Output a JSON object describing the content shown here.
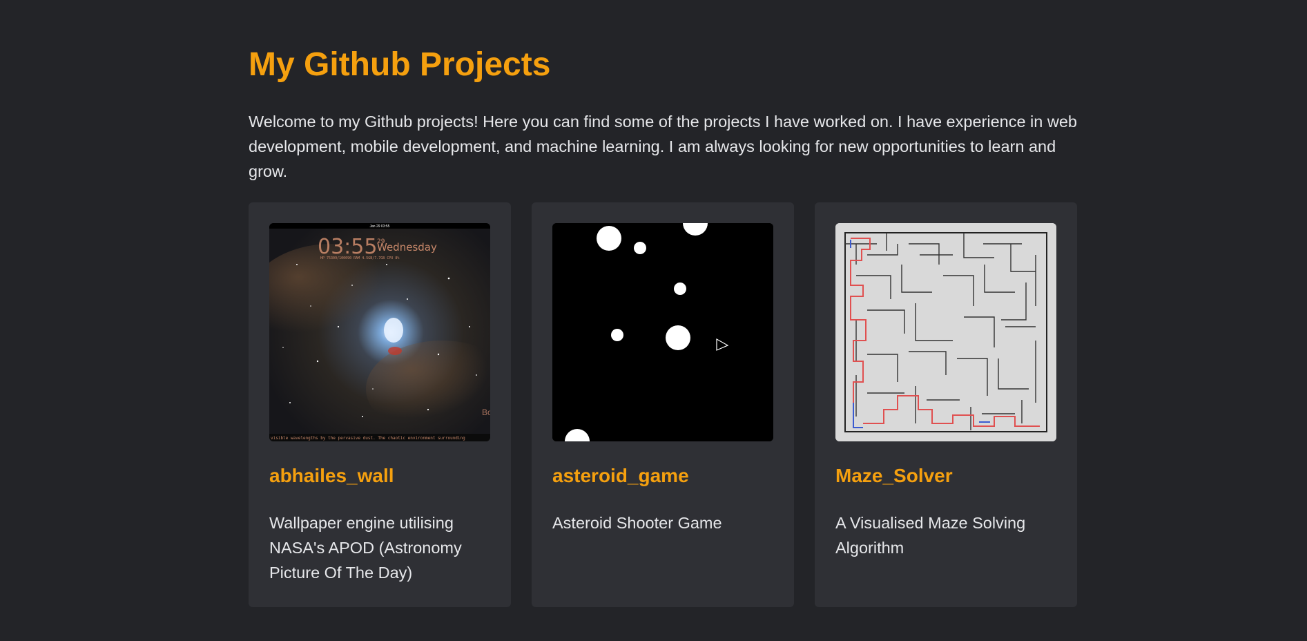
{
  "page": {
    "title": "My Github Projects",
    "intro": "Welcome to my Github projects! Here you can find some of the projects I have worked on. I have experience in web development, mobile development, and machine learning. I am always looking for new opportunities to learn and grow."
  },
  "projects": [
    {
      "name": "abhailes_wall",
      "description": "Wallpaper engine utilising NASA's APOD (Astronomy Picture Of The Day)",
      "thumbnail": {
        "clock_time": "03:55",
        "day_number": "29",
        "weekday": "Wednesday",
        "topbar_text": "Jan 29 03:55",
        "stats_text": "HP 75309/100090   RAM 4.5GB/7.7GB   CPU 8%",
        "caption": "visible wavelengths by the pervasive dust. The chaotic environment surrounding",
        "corner_text": "Bo"
      }
    },
    {
      "name": "asteroid_game",
      "description": "Asteroid Shooter Game"
    },
    {
      "name": "Maze_Solver",
      "description": "A Visualised Maze Solving Algorithm"
    }
  ],
  "colors": {
    "background": "#232428",
    "card": "#2f3035",
    "accent": "#f5a00f",
    "text": "#e6e7ea"
  }
}
